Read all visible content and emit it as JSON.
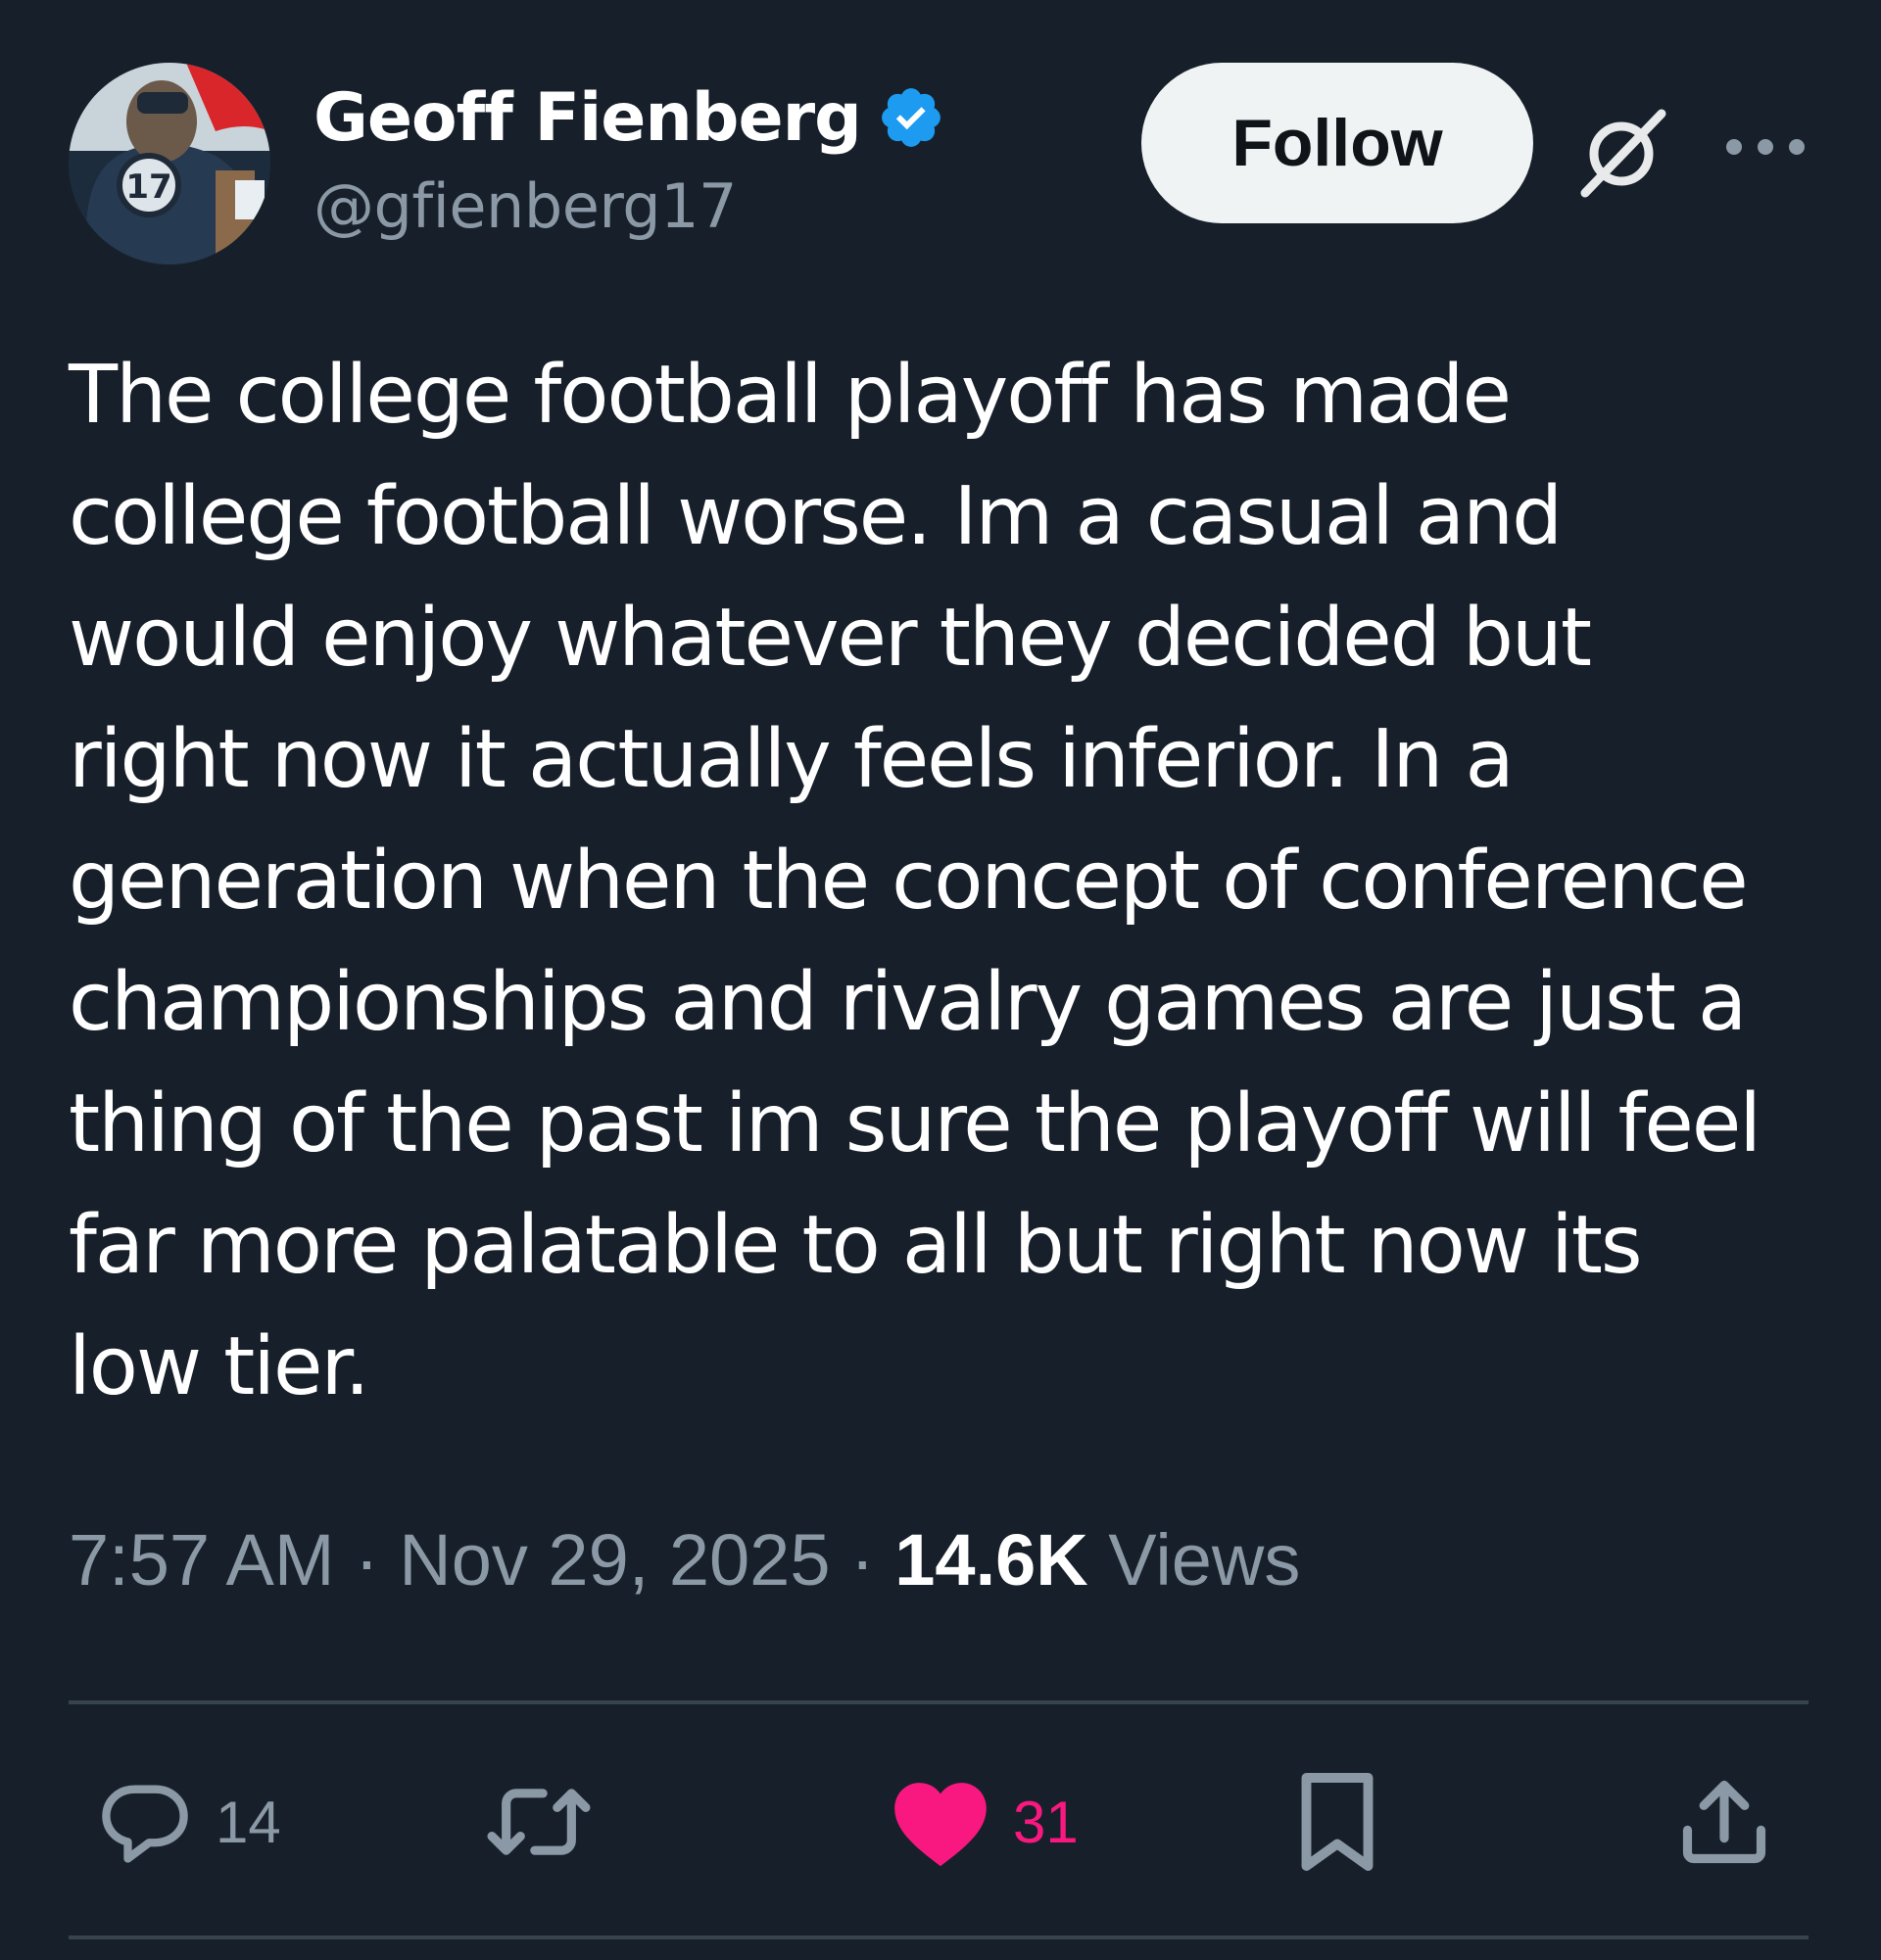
{
  "user": {
    "display_name": "Geoff Fienberg",
    "handle": "@gfienberg17",
    "verified": true,
    "avatar_jersey_number": "17"
  },
  "header": {
    "follow_label": "Follow",
    "grok_icon": "grok-icon",
    "more_icon": "more-icon"
  },
  "tweet": {
    "text": "The college football playoff has made\ncollege football worse. Im a casual and\nwould enjoy whatever they decided but\nright now it actually feels inferior. In a\ngeneration when the concept of conference\nchampionships and rivalry games are just a\nthing of the past im sure the playoff will feel\nfar more palatable to all but right now its\nlow tier."
  },
  "meta": {
    "time": "7:57 AM",
    "separator": " · ",
    "date": "Nov 29, 2025",
    "views_count": "14.6K",
    "views_label": " Views"
  },
  "actions": {
    "replies": "14",
    "reposts": "",
    "likes": "31",
    "liked": true
  },
  "colors": {
    "background": "#17202a",
    "text": "#ffffff",
    "secondary": "#8b98a5",
    "divider": "#38444d",
    "verified": "#1d9bf0",
    "like": "#f91880",
    "follow_bg": "#eff3f4"
  }
}
